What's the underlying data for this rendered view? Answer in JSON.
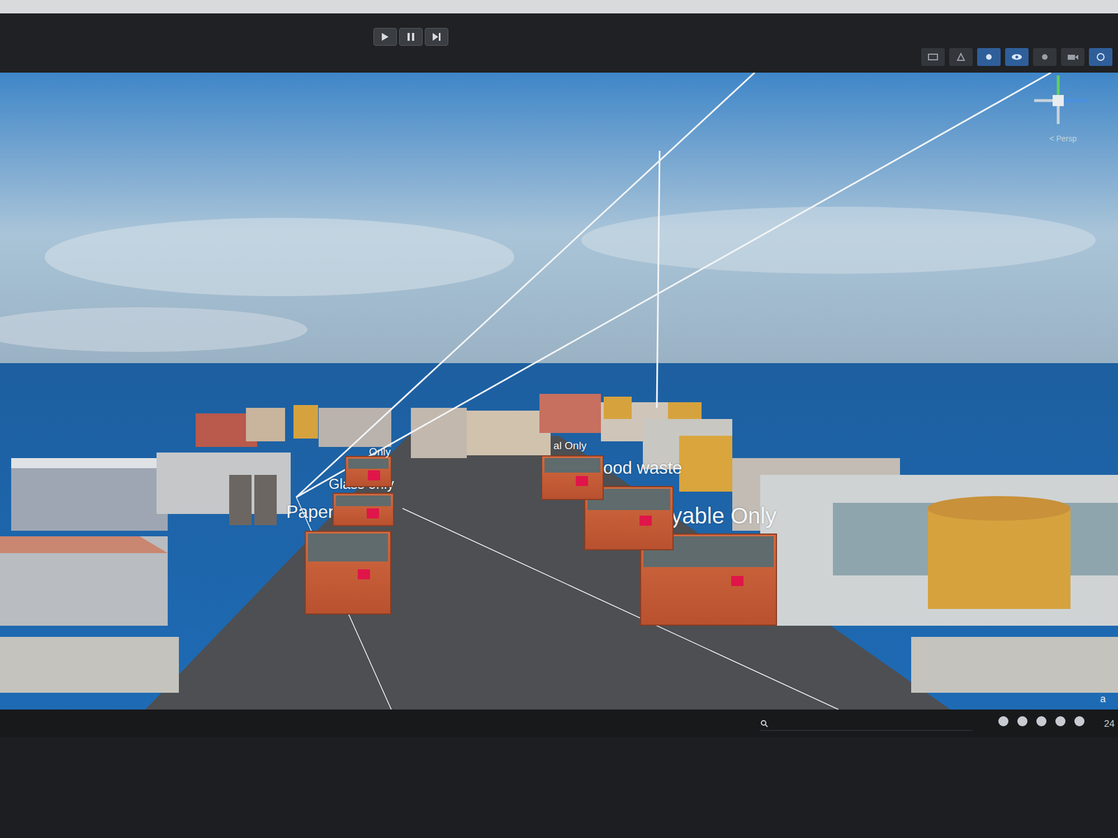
{
  "scene": {
    "view_label": "< Persp",
    "bins": [
      {
        "label": "Paper Only"
      },
      {
        "label": "Glass only"
      },
      {
        "label": "Only"
      },
      {
        "label": "Non-recyable Only"
      },
      {
        "label": "Food waste"
      },
      {
        "label": "al Only"
      }
    ]
  },
  "status_bar": {
    "letter": "a",
    "count": "24"
  }
}
